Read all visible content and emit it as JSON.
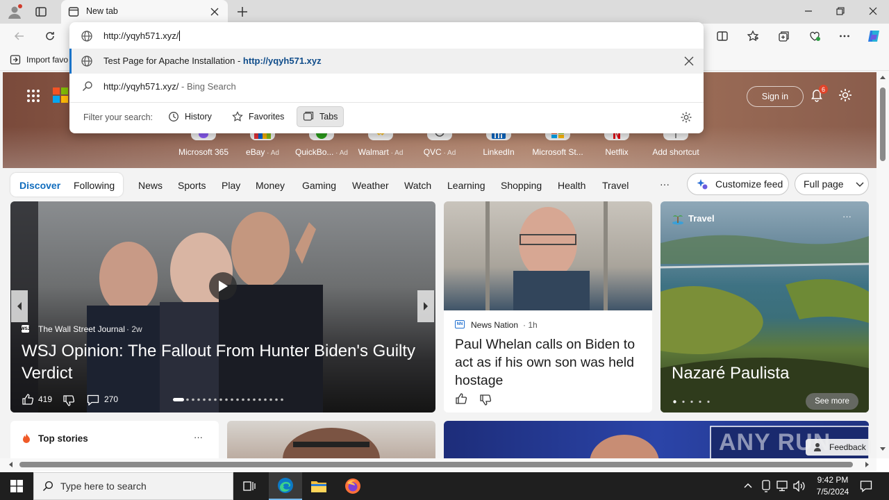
{
  "browser": {
    "tab_title": "New tab",
    "address_value": "http://yqyh571.xyz/",
    "favorites_label": "Import favo"
  },
  "dropdown": {
    "suggestion1_title": "Test Page for Apache Installation",
    "suggestion1_sep": " - ",
    "suggestion1_url": "http://yqyh571.xyz",
    "suggestion2_query": "http://yqyh571.xyz/",
    "suggestion2_suffix": " - Bing Search",
    "filter_label": "Filter your search:",
    "filter_history": "History",
    "filter_favorites": "Favorites",
    "filter_tabs": "Tabs"
  },
  "hero": {
    "signin": "Sign in",
    "notif_count": "6",
    "shortcuts": [
      {
        "label": "Microsoft 365",
        "ad": ""
      },
      {
        "label": "eBay",
        "ad": " · Ad"
      },
      {
        "label": "QuickBo...",
        "ad": " · Ad"
      },
      {
        "label": "Walmart",
        "ad": " · Ad"
      },
      {
        "label": "QVC",
        "ad": " · Ad"
      },
      {
        "label": "LinkedIn",
        "ad": ""
      },
      {
        "label": "Microsoft St...",
        "ad": ""
      },
      {
        "label": "Netflix",
        "ad": ""
      },
      {
        "label": "Add shortcut",
        "ad": ""
      }
    ]
  },
  "nav": {
    "discover": "Discover",
    "following": "Following",
    "items": [
      "News",
      "Sports",
      "Play",
      "Money",
      "Gaming",
      "Weather",
      "Watch",
      "Learning",
      "Shopping",
      "Health",
      "Travel"
    ],
    "more": "···",
    "customize": "Customize feed",
    "fullpage": "Full page"
  },
  "main_story": {
    "source": "The Wall Street Journal",
    "source_logo": "WSJ",
    "age": "· 2w",
    "headline": "WSJ Opinion: The Fallout From Hunter Biden's Guilty Verdict",
    "likes": "419",
    "comments": "270"
  },
  "whelan_story": {
    "source": "News Nation",
    "source_logo": "NN",
    "age": "· 1h",
    "headline": "Paul Whelan calls on Biden to act as if his own son was held hostage"
  },
  "travel_card": {
    "tag": "Travel",
    "title": "Nazaré Paulista",
    "see_more": "See more",
    "more": "···"
  },
  "top_stories": {
    "title": "Top stories",
    "more": "···"
  },
  "feedback": "Feedback",
  "watermark": "ANY RUN",
  "taskbar": {
    "search_placeholder": "Type here to search",
    "time": "9:42 PM",
    "date": "7/5/2024"
  }
}
